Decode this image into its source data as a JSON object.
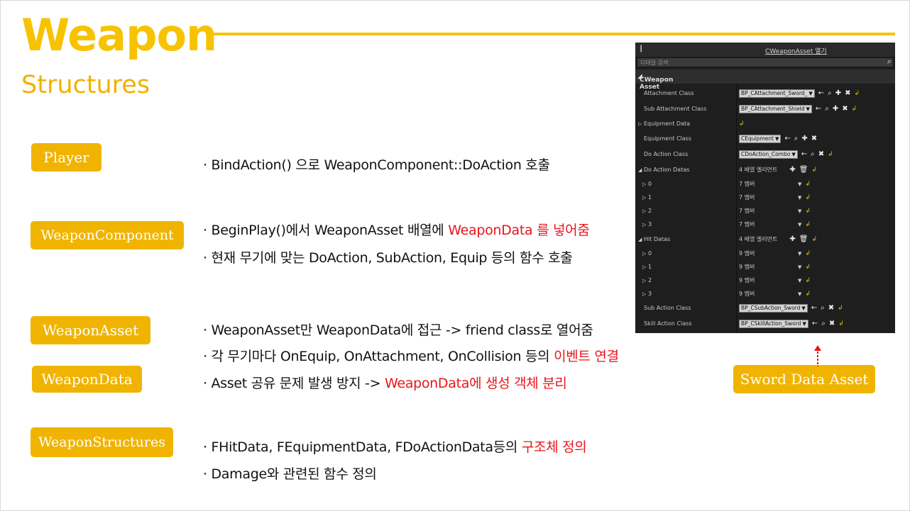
{
  "title": "Weapon",
  "subtitle": "Structures",
  "tags": {
    "player": "Player",
    "weapon_component": "WeaponComponent",
    "weapon_asset": "WeaponAsset",
    "weapon_data": "WeaponData",
    "weapon_structures": "WeaponStructures",
    "sword_data_asset": "Sword Data Asset"
  },
  "bullets": {
    "b1": "· BindAction() 으로 WeaponComponent::DoAction 호출",
    "b2_pre": "· BeginPlay()에서 WeaponAsset 배열에 ",
    "b2_red": "WeaponData 를 넣어줌",
    "b3": "· 현재 무기에 맞는 DoAction, SubAction, Equip 등의 함수 호출",
    "b4": "· WeaponAsset만 WeaponData에 접근 -> friend class로 열어줌",
    "b5_pre": "· 각 무기마다 OnEquip, OnAttachment, OnCollision 등의 ",
    "b5_red": "이벤트 연결",
    "b6_pre": "· Asset 공유 문제 발생 방지 -> ",
    "b6_red": "WeaponData에 생성 객체 분리",
    "b7_pre": "· FHitData, FEquipmentData, FDoActionData등의 ",
    "b7_red": "구조체 정의",
    "b8": "· Damage와 관련된 함수 정의"
  },
  "panel": {
    "open_link": "CWeaponAsset 열기",
    "search_placeholder": "디테일 검색",
    "section": "CWeapon Asset",
    "rows": {
      "attachment_class": "Attachment Class",
      "attachment_value": "BP_CAttachment_Sword_",
      "sub_attachment_class": "Sub Attachment Class",
      "sub_attachment_value": "BP_CAttachment_Shield",
      "equipment_data": "Equipment Data",
      "equipment_class": "Equipment Class",
      "equipment_value": "CEquipment",
      "do_action_class": "Do Action Class",
      "do_action_value": "CDoAction_Combo",
      "do_action_datas": "Do Action Datas",
      "do_action_count": "4 배열 엘리먼트",
      "da0": "0",
      "da0_val": "7 멤버",
      "da1": "1",
      "da1_val": "7 멤버",
      "da2": "2",
      "da2_val": "7 멤버",
      "da3": "3",
      "da3_val": "7 멤버",
      "hit_datas": "Hit Datas",
      "hit_count": "4 배열 엘리먼트",
      "hd0": "0",
      "hd0_val": "9 멤버",
      "hd1": "1",
      "hd1_val": "9 멤버",
      "hd2": "2",
      "hd2_val": "9 멤버",
      "hd3": "3",
      "hd3_val": "9 멤버",
      "sub_action_class": "Sub Action Class",
      "sub_action_value": "BP_CSubAction_Sword",
      "skill_action_class": "Skill Action Class",
      "skill_action_value": "BP_CSkillAction_Sword"
    }
  },
  "colors": {
    "accent": "#f7c300",
    "tag_bg": "#f0b400",
    "highlight": "#e8141b",
    "panel_bg": "#1e1e1e"
  }
}
